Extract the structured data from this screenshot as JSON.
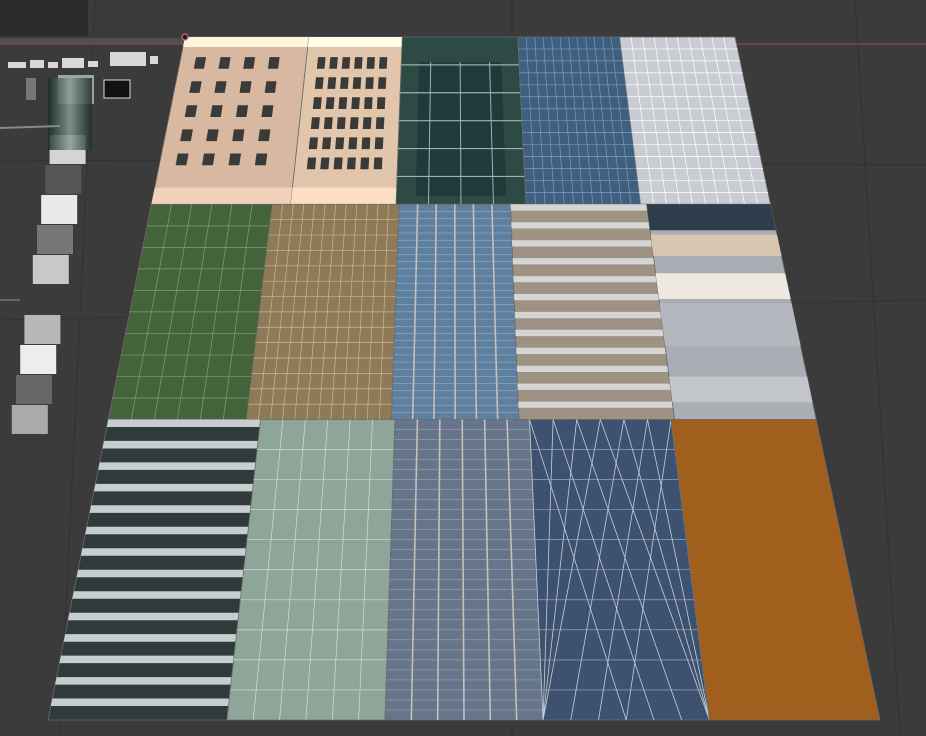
{
  "viewport": {
    "background": "#3b3b3b",
    "grid_color": "#333333",
    "x_axis_color": "#b0454f"
  },
  "texture_atlas": {
    "rows": [
      [
        {
          "name": "tan-brick-facade",
          "color": "#d8b8a0",
          "style": "brick-windows"
        },
        {
          "name": "beige-stone-facade",
          "color": "#e2c6ac",
          "style": "stone-windows"
        },
        {
          "name": "green-curtain-wall",
          "color": "#2e4a45",
          "style": "curtain-bay"
        },
        {
          "name": "blue-grid-glass",
          "color": "#3f5f80",
          "style": "dense-grid"
        },
        {
          "name": "grey-office-facade",
          "color": "#c9ccd2",
          "style": "office-grey"
        }
      ],
      [
        {
          "name": "green-glass-grid",
          "color": "#44633a",
          "style": "glass-grid"
        },
        {
          "name": "brown-window-grid",
          "color": "#8f7a58",
          "style": "brown-grid"
        },
        {
          "name": "blue-vertical-glass",
          "color": "#5f7f9f",
          "style": "vertical-glass"
        },
        {
          "name": "horizontal-band-facade",
          "color": "#9e9282",
          "style": "bands"
        },
        {
          "name": "mixed-floor-facade",
          "color": "#a9adb4",
          "style": "mixed"
        }
      ],
      [
        {
          "name": "dark-ribbon-windows",
          "color": "#2f3b3b",
          "style": "ribbon"
        },
        {
          "name": "pale-green-glass",
          "color": "#8ea59a",
          "style": "glass-grid"
        },
        {
          "name": "grey-blue-mullion",
          "color": "#66758a",
          "style": "vertical-glass"
        },
        {
          "name": "diagrid-facade",
          "color": "#3d5270",
          "style": "diagrid"
        },
        {
          "name": "orange-blank",
          "color": "#a05f1c",
          "style": "solid"
        }
      ]
    ]
  }
}
